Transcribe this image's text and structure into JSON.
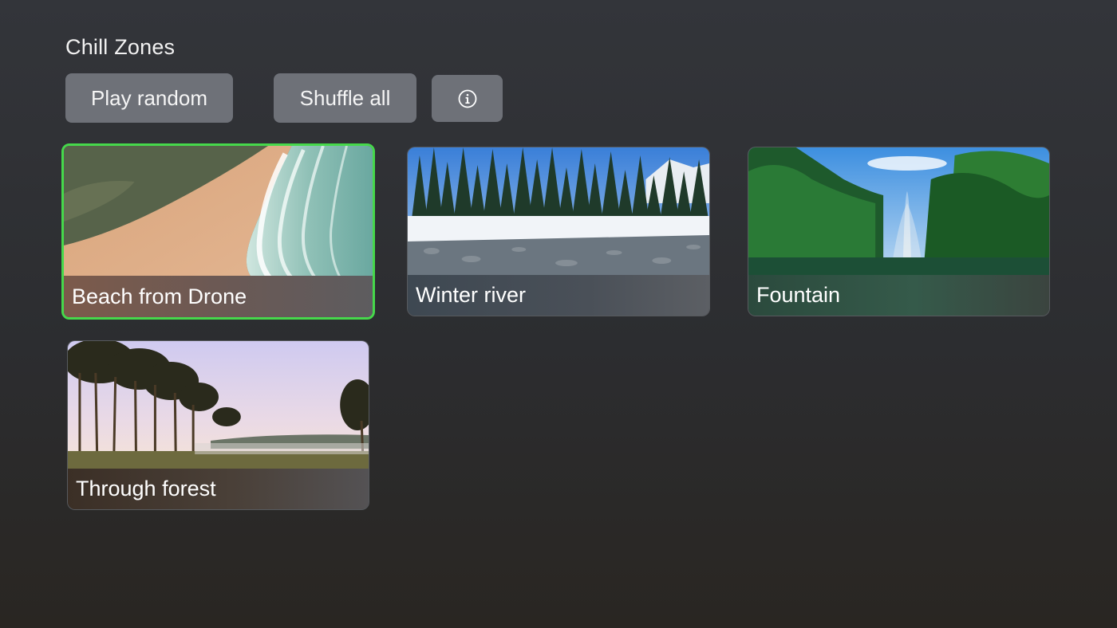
{
  "header": {
    "title": "Chill Zones"
  },
  "actions": {
    "play_random_label": "Play random",
    "shuffle_all_label": "Shuffle all",
    "info_icon": "info-circle-icon"
  },
  "videos": [
    {
      "title": "Beach from Drone",
      "focused": true
    },
    {
      "title": "Winter river",
      "focused": false
    },
    {
      "title": "Fountain",
      "focused": false
    },
    {
      "title": "Through forest",
      "focused": false
    }
  ],
  "colors": {
    "focus_ring": "#46d84b",
    "button_bg": "#6e7178"
  }
}
